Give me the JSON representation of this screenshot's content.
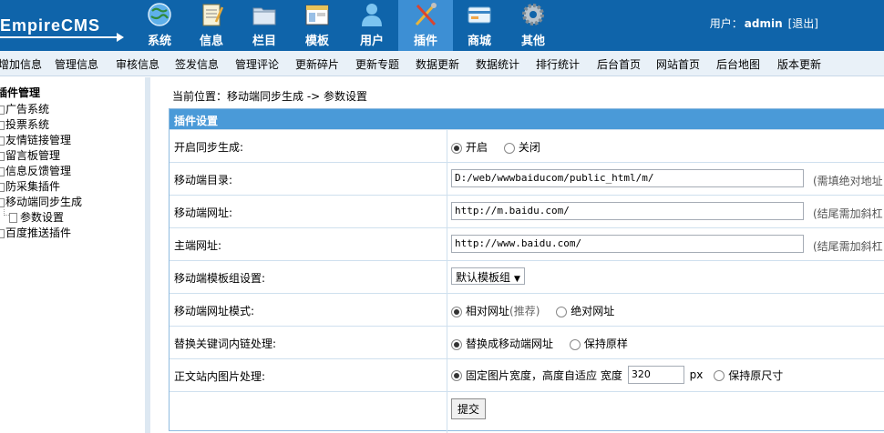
{
  "header": {
    "logo_text": "EmpireCMS",
    "nav": [
      {
        "label": "系统",
        "icon": "globe-icon",
        "active": false
      },
      {
        "label": "信息",
        "icon": "notepad-icon",
        "active": false
      },
      {
        "label": "栏目",
        "icon": "folder-icon",
        "active": false
      },
      {
        "label": "模板",
        "icon": "window-icon",
        "active": false
      },
      {
        "label": "用户",
        "icon": "user-icon",
        "active": false
      },
      {
        "label": "插件",
        "icon": "tools-icon",
        "active": true
      },
      {
        "label": "商城",
        "icon": "card-icon",
        "active": false
      },
      {
        "label": "其他",
        "icon": "gear-icon",
        "active": false
      }
    ],
    "user_label": "用户：",
    "username": "admin",
    "logout_label": "[退出]"
  },
  "subnav": [
    "增加信息",
    "管理信息",
    "审核信息",
    "签发信息",
    "管理评论",
    "更新碎片",
    "更新专题",
    "数据更新",
    "数据统计",
    "排行统计",
    "后台首页",
    "网站首页",
    "后台地图",
    "版本更新"
  ],
  "sidebar": {
    "title": "插件管理",
    "items": [
      "广告系统",
      "投票系统",
      "友情链接管理",
      "留言板管理",
      "信息反馈管理",
      "防采集插件",
      "移动端同步生成"
    ],
    "leaf": "参数设置",
    "last_item": "百度推送插件"
  },
  "main": {
    "breadcrumb": "当前位置：移动端同步生成 -> 参数设置",
    "panel_title": "插件设置",
    "rows": {
      "sync": {
        "label": "开启同步生成:",
        "opt1": "开启",
        "opt2": "关闭"
      },
      "dir": {
        "label": "移动端目录:",
        "value": "D:/web/wwwbaiducom/public_html/m/",
        "note": "(需填绝对地址"
      },
      "mobile_url": {
        "label": "移动端网址:",
        "value": "http://m.baidu.com/",
        "note": "(结尾需加斜杠"
      },
      "main_url": {
        "label": "主端网址:",
        "value": "http://www.baidu.com/",
        "note": "(结尾需加斜杠"
      },
      "template": {
        "label": "移动端模板组设置:",
        "selected": "默认模板组"
      },
      "url_mode": {
        "label": "移动端网址模式:",
        "opt1": "相对网址",
        "opt1_hint": "(推荐)",
        "opt2": "绝对网址"
      },
      "keyword": {
        "label": "替换关键词内链处理:",
        "opt1": "替换成移动端网址",
        "opt2": "保持原样"
      },
      "image": {
        "label": "正文站内图片处理:",
        "opt1": "固定图片宽度，高度自适应 宽度",
        "width_value": "320",
        "unit": "px",
        "opt2": "保持原尺寸"
      }
    },
    "submit_label": "提交"
  },
  "colors": {
    "header_bg": "#0f64aa",
    "active_tab": "#3d8fd4",
    "panel_header": "#4a9ad8"
  }
}
